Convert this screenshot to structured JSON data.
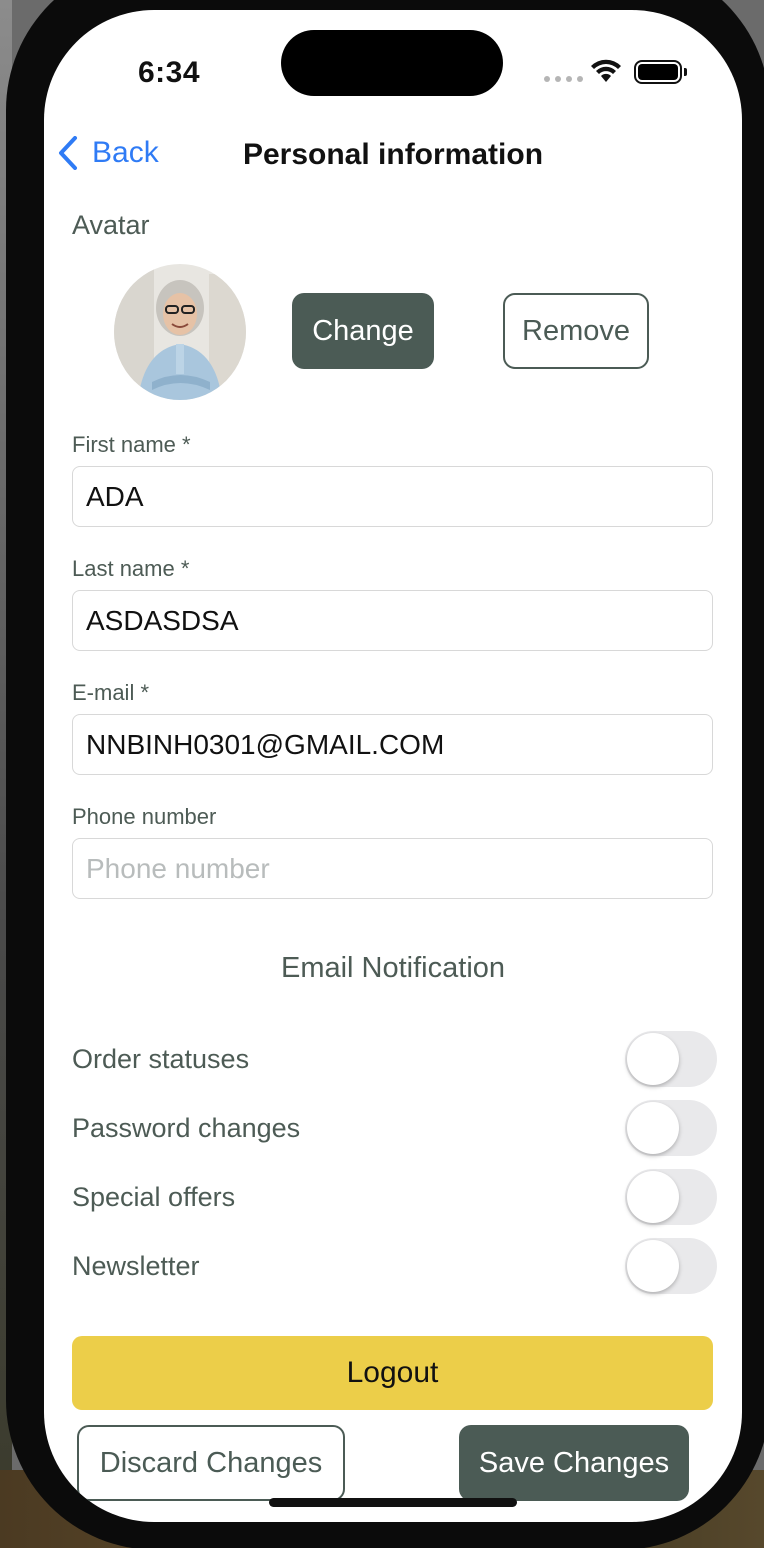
{
  "status_bar": {
    "time": "6:34"
  },
  "nav": {
    "back_label": "Back",
    "title": "Personal information"
  },
  "avatar": {
    "section_label": "Avatar",
    "change_label": "Change",
    "remove_label": "Remove"
  },
  "form": {
    "first_name": {
      "label": "First name *",
      "value": "ADA"
    },
    "last_name": {
      "label": "Last name *",
      "value": "ASDASDSA"
    },
    "email": {
      "label": "E-mail *",
      "value": "NNBINH0301@GMAIL.COM"
    },
    "phone": {
      "label": "Phone number",
      "value": "",
      "placeholder": "Phone number"
    }
  },
  "notifications": {
    "title": "Email Notification",
    "items": [
      {
        "label": "Order statuses",
        "enabled": false
      },
      {
        "label": "Password changes",
        "enabled": false
      },
      {
        "label": "Special offers",
        "enabled": false
      },
      {
        "label": "Newsletter",
        "enabled": false
      }
    ]
  },
  "actions": {
    "logout_label": "Logout",
    "discard_label": "Discard Changes",
    "save_label": "Save Changes"
  },
  "colors": {
    "accent_dark": "#4b5b55",
    "link_blue": "#2f7bf5",
    "logout_yellow": "#ecce49",
    "toggle_off": "#e9e9eb"
  },
  "icons": [
    "chevron-left-icon",
    "wifi-icon",
    "battery-icon",
    "cellular-signal-icon"
  ]
}
